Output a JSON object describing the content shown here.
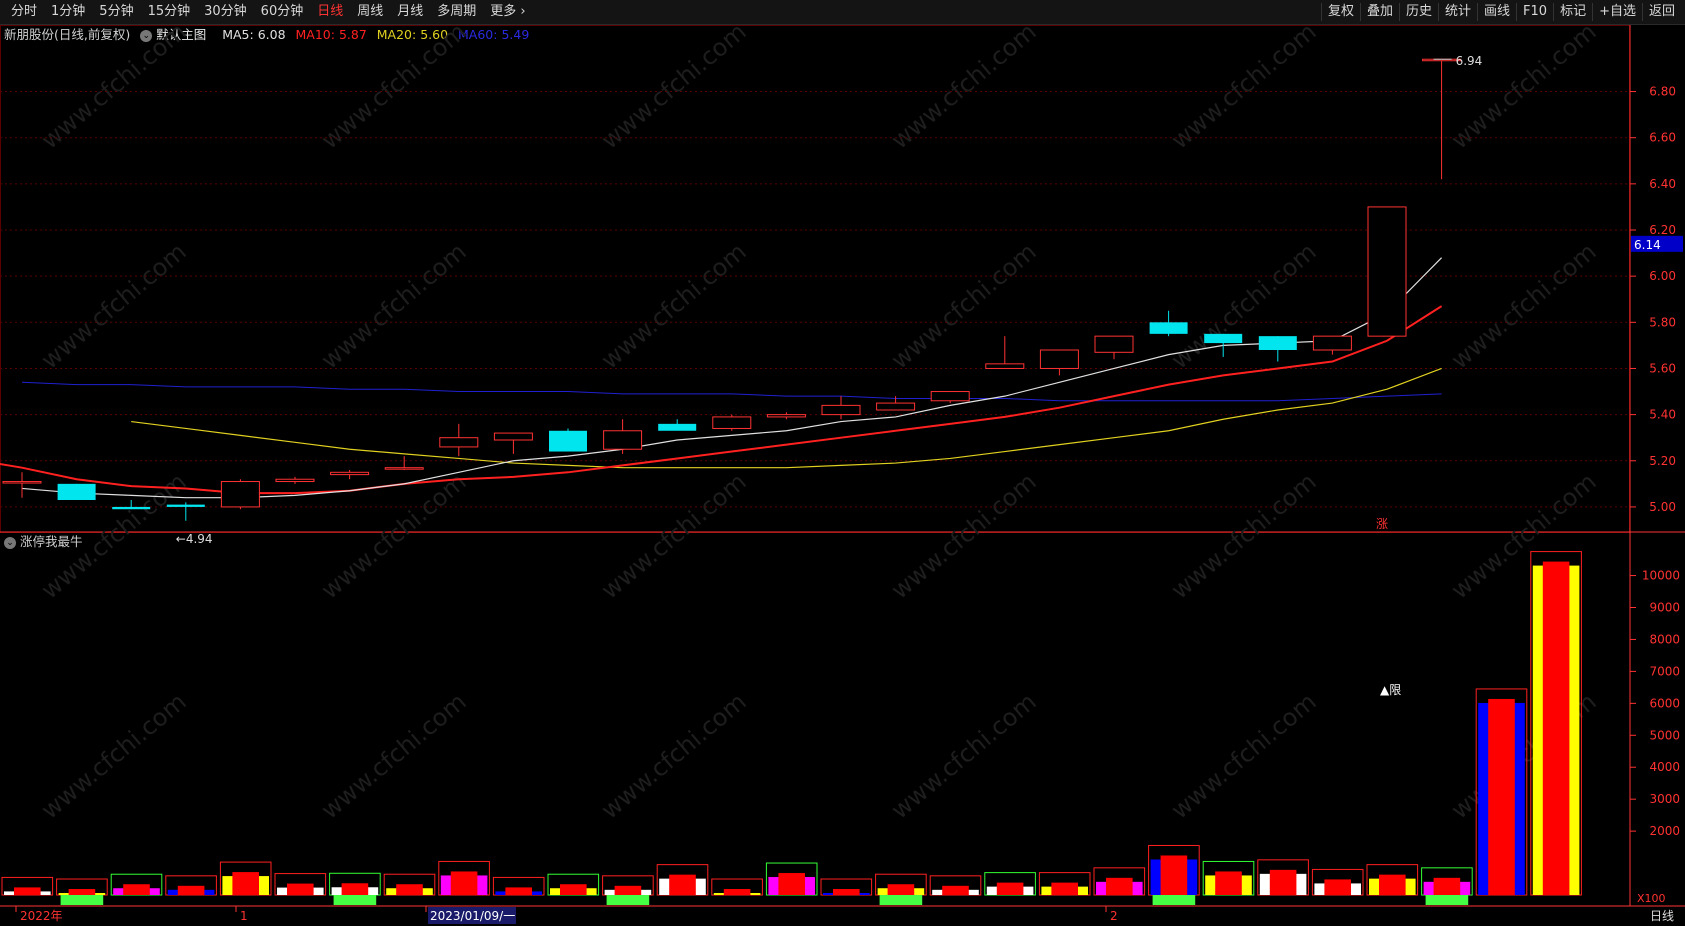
{
  "toolbar": {
    "periods": [
      "分时",
      "1分钟",
      "5分钟",
      "15分钟",
      "30分钟",
      "60分钟",
      "日线",
      "周线",
      "月线",
      "多周期",
      "更多 ›"
    ],
    "active_period": "日线",
    "right_items": [
      "复权",
      "叠加",
      "历史",
      "统计",
      "画线",
      "F10",
      "标记",
      "+自选",
      "返回"
    ]
  },
  "legend": {
    "stock": "新朋股份(日线,前复权)",
    "template": "默认主图",
    "ma5": "MA5: 6.08",
    "ma10": "MA10: 5.87",
    "ma20": "MA20: 5.60",
    "ma60": "MA60: 5.49"
  },
  "sub_indicator": {
    "name": "涨停我最牛"
  },
  "colors": {
    "up": "#ff3232",
    "down": "#00e5ee",
    "ma5": "#e0e0e0",
    "ma10": "#ff2020",
    "ma20": "#e0d020",
    "ma60": "#2020d0",
    "grid": "#5a0000",
    "axis": "#ff3232"
  },
  "price_axis": {
    "ticks": [
      "6.80",
      "6.60",
      "6.40",
      "6.20",
      "6.00",
      "5.80",
      "5.60",
      "5.40",
      "5.20",
      "5.00"
    ],
    "current": "6.14"
  },
  "volume_axis": {
    "ticks": [
      "10000",
      "9000",
      "8000",
      "7000",
      "6000",
      "5000",
      "4000",
      "3000",
      "2000"
    ],
    "unit": "X100"
  },
  "annotations": {
    "high": "6.94",
    "low": "4.94",
    "limit_up_marker": "涨",
    "volume_tag": "▲限"
  },
  "date_axis": {
    "labels": [
      "2022年",
      "1",
      "2023/01/09/一",
      "2"
    ],
    "period_label": "日线"
  },
  "watermark": "www.cfchi.com",
  "chart_data": {
    "type": "candlestick",
    "candles": [
      {
        "o": 5.11,
        "h": 5.15,
        "l": 5.04,
        "c": 5.11
      },
      {
        "o": 5.1,
        "h": 5.1,
        "l": 5.03,
        "c": 5.03
      },
      {
        "o": 5.0,
        "h": 5.03,
        "l": 4.99,
        "c": 4.99
      },
      {
        "o": 5.01,
        "h": 5.02,
        "l": 4.94,
        "c": 5.0
      },
      {
        "o": 5.0,
        "h": 5.12,
        "l": 4.99,
        "c": 5.11
      },
      {
        "o": 5.11,
        "h": 5.13,
        "l": 5.1,
        "c": 5.12
      },
      {
        "o": 5.14,
        "h": 5.16,
        "l": 5.12,
        "c": 5.15
      },
      {
        "o": 5.17,
        "h": 5.22,
        "l": 5.16,
        "c": 5.17
      },
      {
        "o": 5.26,
        "h": 5.36,
        "l": 5.22,
        "c": 5.3
      },
      {
        "o": 5.29,
        "h": 5.32,
        "l": 5.23,
        "c": 5.32
      },
      {
        "o": 5.33,
        "h": 5.34,
        "l": 5.24,
        "c": 5.24
      },
      {
        "o": 5.25,
        "h": 5.38,
        "l": 5.23,
        "c": 5.33
      },
      {
        "o": 5.36,
        "h": 5.38,
        "l": 5.34,
        "c": 5.33
      },
      {
        "o": 5.34,
        "h": 5.4,
        "l": 5.33,
        "c": 5.39
      },
      {
        "o": 5.39,
        "h": 5.41,
        "l": 5.38,
        "c": 5.4
      },
      {
        "o": 5.4,
        "h": 5.48,
        "l": 5.38,
        "c": 5.44
      },
      {
        "o": 5.42,
        "h": 5.48,
        "l": 5.42,
        "c": 5.45
      },
      {
        "o": 5.46,
        "h": 5.5,
        "l": 5.45,
        "c": 5.5
      },
      {
        "o": 5.6,
        "h": 5.74,
        "l": 5.6,
        "c": 5.62
      },
      {
        "o": 5.6,
        "h": 5.68,
        "l": 5.57,
        "c": 5.68
      },
      {
        "o": 5.67,
        "h": 5.74,
        "l": 5.64,
        "c": 5.74
      },
      {
        "o": 5.8,
        "h": 5.85,
        "l": 5.74,
        "c": 5.75
      },
      {
        "o": 5.75,
        "h": 5.75,
        "l": 5.65,
        "c": 5.71
      },
      {
        "o": 5.74,
        "h": 5.74,
        "l": 5.63,
        "c": 5.68
      },
      {
        "o": 5.68,
        "h": 5.74,
        "l": 5.66,
        "c": 5.74
      },
      {
        "o": 5.74,
        "h": 6.3,
        "l": 5.74,
        "c": 6.3
      },
      {
        "o": 6.94,
        "h": 6.94,
        "l": 6.42,
        "c": 6.94
      }
    ],
    "ma5": [
      5.08,
      5.06,
      5.05,
      5.04,
      5.04,
      5.05,
      5.07,
      5.1,
      5.15,
      5.2,
      5.22,
      5.25,
      5.29,
      5.31,
      5.33,
      5.37,
      5.39,
      5.44,
      5.48,
      5.54,
      5.6,
      5.66,
      5.7,
      5.71,
      5.72,
      5.84,
      6.08
    ],
    "ma10": [
      5.21,
      5.17,
      5.12,
      5.09,
      5.08,
      5.06,
      5.06,
      5.07,
      5.1,
      5.12,
      5.13,
      5.15,
      5.18,
      5.21,
      5.24,
      5.27,
      5.3,
      5.33,
      5.36,
      5.39,
      5.43,
      5.48,
      5.53,
      5.57,
      5.6,
      5.63,
      5.72,
      5.87
    ],
    "ma20": [
      5.37,
      5.34,
      5.31,
      5.28,
      5.25,
      5.23,
      5.21,
      5.19,
      5.18,
      5.17,
      5.17,
      5.17,
      5.17,
      5.18,
      5.19,
      5.21,
      5.24,
      5.27,
      5.3,
      5.33,
      5.38,
      5.42,
      5.45,
      5.51,
      5.6
    ],
    "ma60": [
      5.54,
      5.53,
      5.53,
      5.52,
      5.52,
      5.52,
      5.51,
      5.51,
      5.5,
      5.5,
      5.5,
      5.49,
      5.49,
      5.49,
      5.48,
      5.48,
      5.47,
      5.47,
      5.47,
      5.46,
      5.46,
      5.46,
      5.46,
      5.46,
      5.47,
      5.48,
      5.49
    ],
    "volume": [
      300,
      250,
      400,
      350,
      780,
      420,
      430,
      400,
      800,
      300,
      400,
      350,
      700,
      250,
      750,
      250,
      400,
      350,
      450,
      450,
      600,
      1300,
      800,
      850,
      550,
      700,
      600,
      6200,
      10500
    ],
    "price_range": [
      4.9,
      6.98
    ],
    "volume_range": [
      0,
      10800
    ]
  }
}
